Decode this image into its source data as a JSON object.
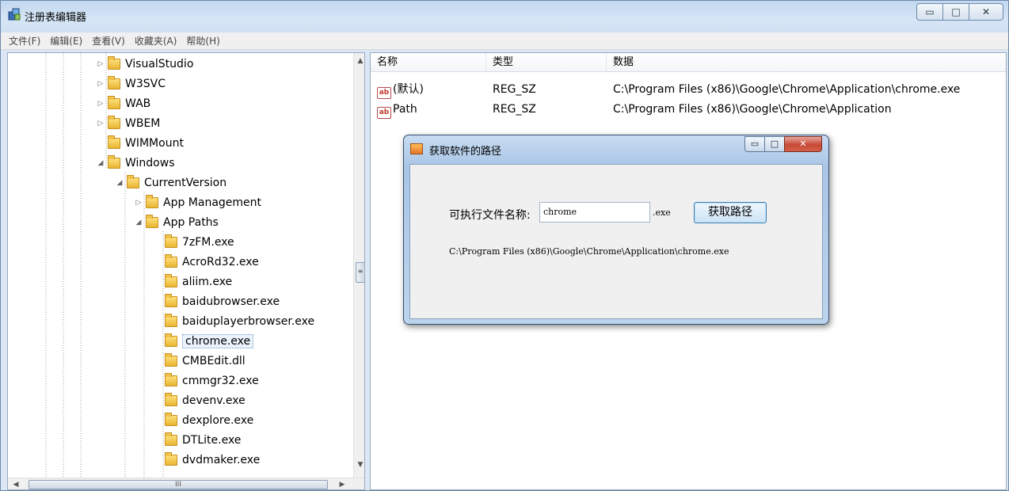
{
  "window": {
    "title": "注册表编辑器",
    "controls": {
      "minimize": "▭",
      "maximize": "□",
      "close": "✕"
    }
  },
  "menu": [
    "文件(F)",
    "编辑(E)",
    "查看(V)",
    "收藏夹(A)",
    "帮助(H)"
  ],
  "tree": {
    "items": [
      {
        "label": "VisualStudio",
        "level": 0,
        "expander": "▷"
      },
      {
        "label": "W3SVC",
        "level": 0,
        "expander": "▷"
      },
      {
        "label": "WAB",
        "level": 0,
        "expander": "▷"
      },
      {
        "label": "WBEM",
        "level": 0,
        "expander": "▷"
      },
      {
        "label": "WIMMount",
        "level": 0,
        "expander": ""
      },
      {
        "label": "Windows",
        "level": 0,
        "expander": "◢"
      },
      {
        "label": "CurrentVersion",
        "level": 1,
        "expander": "◢"
      },
      {
        "label": "App Management",
        "level": 2,
        "expander": "▷"
      },
      {
        "label": "App Paths",
        "level": 2,
        "expander": "◢"
      },
      {
        "label": "7zFM.exe",
        "level": 3,
        "expander": ""
      },
      {
        "label": "AcroRd32.exe",
        "level": 3,
        "expander": ""
      },
      {
        "label": "aliim.exe",
        "level": 3,
        "expander": ""
      },
      {
        "label": "baidubrowser.exe",
        "level": 3,
        "expander": ""
      },
      {
        "label": "baiduplayerbrowser.exe",
        "level": 3,
        "expander": ""
      },
      {
        "label": "chrome.exe",
        "level": 3,
        "expander": "",
        "selected": true
      },
      {
        "label": "CMBEdit.dll",
        "level": 3,
        "expander": ""
      },
      {
        "label": "cmmgr32.exe",
        "level": 3,
        "expander": ""
      },
      {
        "label": "devenv.exe",
        "level": 3,
        "expander": ""
      },
      {
        "label": "dexplore.exe",
        "level": 3,
        "expander": ""
      },
      {
        "label": "DTLite.exe",
        "level": 3,
        "expander": ""
      },
      {
        "label": "dvdmaker.exe",
        "level": 3,
        "expander": ""
      }
    ],
    "scroll": {
      "up": "▲",
      "down": "▼",
      "left": "◀",
      "right": "▶",
      "vgrip": "≡",
      "hgrip": "III"
    }
  },
  "list": {
    "columns": [
      "名称",
      "类型",
      "数据"
    ],
    "rows": [
      {
        "name": "(默认)",
        "type": "REG_SZ",
        "data": "C:\\Program Files (x86)\\Google\\Chrome\\Application\\chrome.exe",
        "icon": "ab"
      },
      {
        "name": "Path",
        "type": "REG_SZ",
        "data": "C:\\Program Files (x86)\\Google\\Chrome\\Application",
        "icon": "ab"
      }
    ]
  },
  "dialog": {
    "title": "获取软件的路径",
    "label": "可执行文件名称:",
    "input_value": "chrome",
    "ext": ".exe",
    "button": "获取路径",
    "result": "C:\\Program Files (x86)\\Google\\Chrome\\Application\\chrome.exe",
    "controls": {
      "minimize": "▭",
      "maximize": "□",
      "close": "✕"
    }
  },
  "colors": {
    "accent": "#3c7fb1",
    "folder": "#e8b531",
    "close": "#c74a36"
  }
}
